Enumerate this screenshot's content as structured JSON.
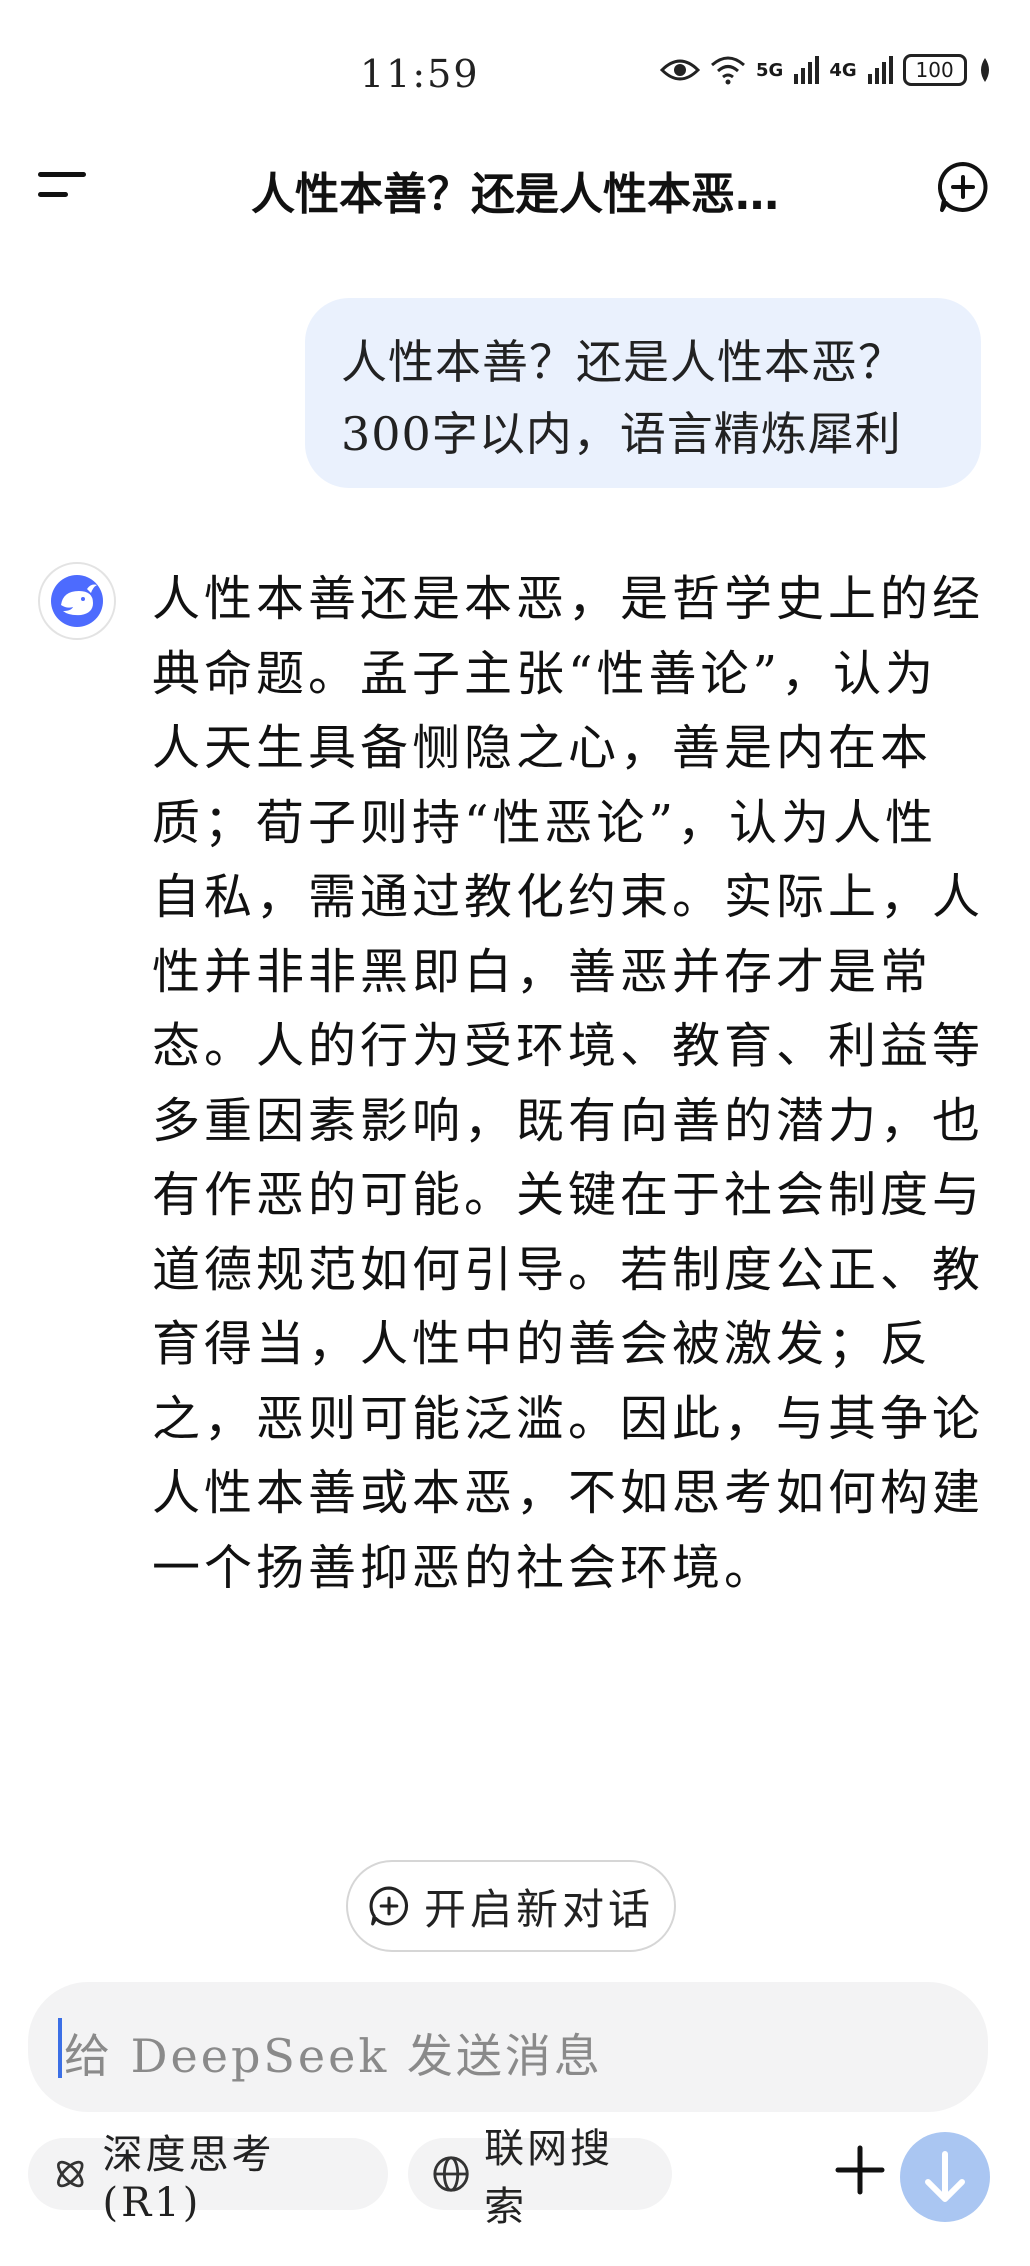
{
  "status_bar": {
    "time": "11:59",
    "battery": "100",
    "signal_1": "5G",
    "signal_2": "4G"
  },
  "header": {
    "title": "人性本善？还是人性本恶…"
  },
  "user_message": {
    "lines": [
      "人性本善？还是人性本恶？",
      "300字以内，语言精炼犀利"
    ]
  },
  "assistant_message": {
    "lines": [
      "人性本善还是本恶，是哲学史上的经",
      "典命题。孟子主张“性善论”，认为",
      "人天生具备恻隐之心，善是内在本",
      "质；荀子则持“性恶论”，认为人性",
      "自私，需通过教化约束。实际上，人",
      "性并非非黑即白，善恶并存才是常",
      "态。人的行为受环境、教育、利益等",
      "多重因素影响，既有向善的潜力，也",
      "有作恶的可能。关键在于社会制度与",
      "道德规范如何引导。若制度公正、教",
      "育得当，人性中的善会被激发；反",
      "之，恶则可能泛滥。因此，与其争论",
      "人性本善或本恶，不如思考如何构建",
      "一个扬善抑恶的社会环境。"
    ]
  },
  "new_chat_button": {
    "label": "开启新对话"
  },
  "composer": {
    "placeholder": "给 DeepSeek 发送消息"
  },
  "tools": {
    "deep_think_label": "深度思考 (R1)",
    "web_search_label": "联网搜索"
  },
  "colors": {
    "accent": "#4d6bfe",
    "user_bubble": "#eaf1fd"
  }
}
